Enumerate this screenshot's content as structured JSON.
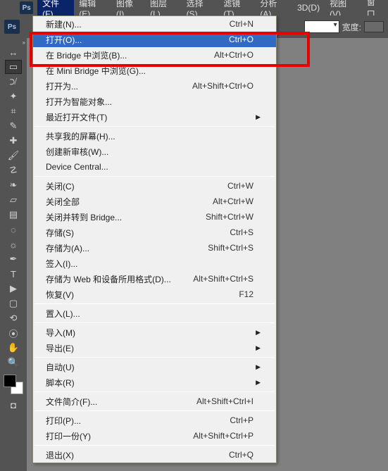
{
  "app": {
    "ps_badge": "Ps"
  },
  "menubar": {
    "items": [
      "文件(F)",
      "编辑(E)",
      "图像(I)",
      "图层(L)",
      "选择(S)",
      "滤镜(T)",
      "分析(A)",
      "3D(D)",
      "视图(V)",
      "窗口"
    ]
  },
  "options": {
    "width_label": "宽度:"
  },
  "file_menu": {
    "groups": [
      [
        {
          "label": "新建(N)...",
          "shortcut": "Ctrl+N"
        },
        {
          "label": "打开(O)...",
          "shortcut": "Ctrl+O",
          "highlight": true
        },
        {
          "label": "在 Bridge 中浏览(B)...",
          "shortcut": "Alt+Ctrl+O"
        },
        {
          "label": "在 Mini Bridge 中浏览(G)..."
        },
        {
          "label": "打开为...",
          "shortcut": "Alt+Shift+Ctrl+O"
        },
        {
          "label": "打开为智能对象..."
        },
        {
          "label": "最近打开文件(T)",
          "submenu": true
        }
      ],
      [
        {
          "label": "共享我的屏幕(H)..."
        },
        {
          "label": "创建新审核(W)..."
        },
        {
          "label": "Device Central..."
        }
      ],
      [
        {
          "label": "关闭(C)",
          "shortcut": "Ctrl+W"
        },
        {
          "label": "关闭全部",
          "shortcut": "Alt+Ctrl+W"
        },
        {
          "label": "关闭并转到 Bridge...",
          "shortcut": "Shift+Ctrl+W"
        },
        {
          "label": "存储(S)",
          "shortcut": "Ctrl+S"
        },
        {
          "label": "存储为(A)...",
          "shortcut": "Shift+Ctrl+S"
        },
        {
          "label": "签入(I)..."
        },
        {
          "label": "存储为 Web 和设备所用格式(D)...",
          "shortcut": "Alt+Shift+Ctrl+S"
        },
        {
          "label": "恢复(V)",
          "shortcut": "F12"
        }
      ],
      [
        {
          "label": "置入(L)..."
        }
      ],
      [
        {
          "label": "导入(M)",
          "submenu": true
        },
        {
          "label": "导出(E)",
          "submenu": true
        }
      ],
      [
        {
          "label": "自动(U)",
          "submenu": true
        },
        {
          "label": "脚本(R)",
          "submenu": true
        }
      ],
      [
        {
          "label": "文件简介(F)...",
          "shortcut": "Alt+Shift+Ctrl+I"
        }
      ],
      [
        {
          "label": "打印(P)...",
          "shortcut": "Ctrl+P"
        },
        {
          "label": "打印一份(Y)",
          "shortcut": "Alt+Shift+Ctrl+P"
        }
      ],
      [
        {
          "label": "退出(X)",
          "shortcut": "Ctrl+Q"
        }
      ]
    ]
  },
  "tools": [
    "move",
    "marquee",
    "lasso",
    "wand",
    "crop",
    "eyedropper",
    "heal",
    "brush",
    "stamp",
    "history",
    "eraser",
    "gradient",
    "blur",
    "dodge",
    "pen",
    "type",
    "path-sel",
    "rect",
    "hand",
    "zoom",
    "rotate3d",
    "roll3d",
    "mask"
  ]
}
